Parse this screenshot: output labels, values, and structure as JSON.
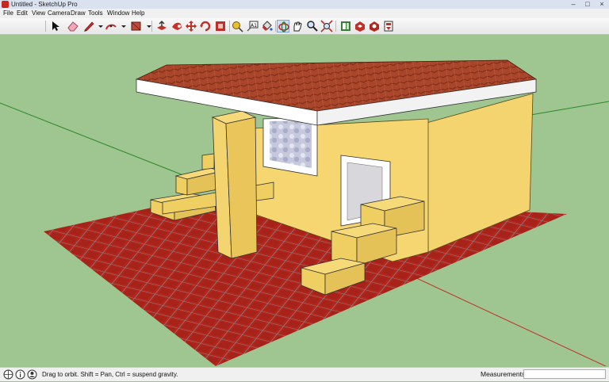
{
  "window": {
    "title": "Untitled - SketchUp Pro"
  },
  "menu": [
    "File",
    "Edit",
    "View",
    "Camera",
    "Draw",
    "Tools",
    "Window",
    "Help"
  ],
  "toolbar": {
    "tools": [
      {
        "name": "select-tool-icon"
      },
      {
        "name": "eraser-tool-icon"
      },
      {
        "name": "pencil-line-tool-icon"
      },
      {
        "name": "arc-tool-icon"
      },
      {
        "name": "rectangle-tool-icon"
      },
      {
        "name": "push-pull-tool-icon"
      },
      {
        "name": "follow-me-tool-icon"
      },
      {
        "name": "move-tool-icon"
      },
      {
        "name": "rotate-tool-icon"
      },
      {
        "name": "offset-tool-icon"
      },
      {
        "name": "tape-measure-tool-icon"
      },
      {
        "name": "text-tool-icon"
      },
      {
        "name": "paint-bucket-tool-icon"
      },
      {
        "name": "orbit-tool-icon",
        "active": true
      },
      {
        "name": "pan-tool-icon"
      },
      {
        "name": "zoom-tool-icon"
      },
      {
        "name": "zoom-extents-tool-icon"
      },
      {
        "name": "warehouse-icon"
      },
      {
        "name": "share-model-icon"
      },
      {
        "name": "extension-warehouse-icon"
      },
      {
        "name": "send-to-layout-icon"
      }
    ]
  },
  "status": {
    "message": "Drag to orbit. Shift = Pan, Ctrl = suspend gravity.",
    "measurements_label": "Measurements",
    "measurements_value": ""
  },
  "colors": {
    "ground": "#9fc590",
    "floor_tile": "#b3261c",
    "wall": "#f5d671",
    "wall_shadow": "#e9c55a",
    "roof_tile": "#a8452a",
    "fascia": "#ffffff",
    "window_glass": "#c9cbe0"
  }
}
